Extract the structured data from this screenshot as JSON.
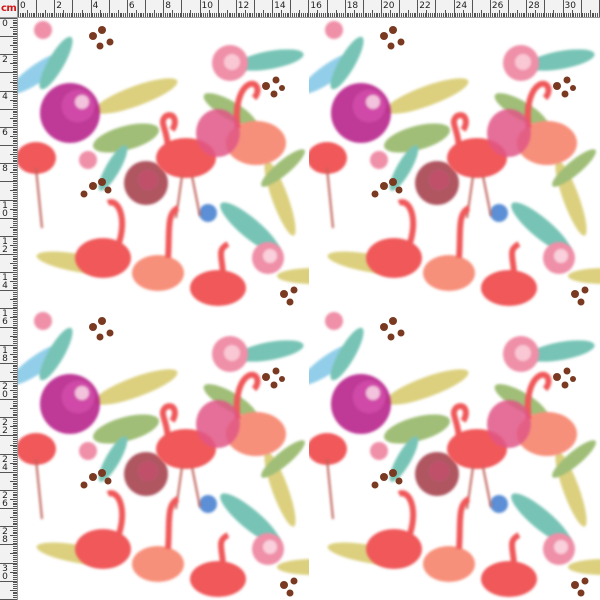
{
  "ruler": {
    "unit_label": "cm",
    "top_numbers": [
      "0",
      "2",
      "4",
      "6",
      "8",
      "10",
      "12",
      "14",
      "16",
      "18",
      "20",
      "22",
      "24",
      "26",
      "28",
      "30"
    ],
    "left_numbers": [
      "0",
      "2",
      "4",
      "6",
      "8",
      "10",
      "12",
      "14",
      "16",
      "18",
      "20",
      "22",
      "24",
      "26",
      "28",
      "30"
    ]
  },
  "pattern": {
    "description_icons": [
      "flamingo-icon",
      "flower-icon",
      "leaf-icon",
      "berry-icon"
    ],
    "colors": {
      "flamingo": "#f0585a",
      "flamingo_light": "#f7907a",
      "magenta_flower": "#b8238c",
      "pink_flower": "#ef8fa8",
      "leaf_green": "#8fb35e",
      "leaf_yellow": "#d6c868",
      "leaf_teal": "#5fb9a8",
      "leaf_blue": "#7fc6e6",
      "berry": "#7a3a22",
      "maroon": "#9b2a3a"
    }
  }
}
